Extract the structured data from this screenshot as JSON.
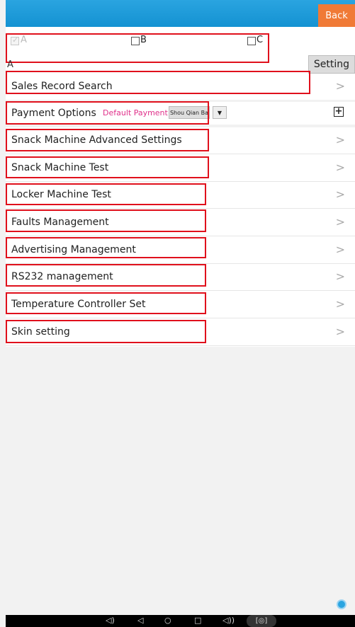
{
  "header": {
    "back_label": "Back"
  },
  "checkboxes": [
    {
      "label": "A",
      "checked": true,
      "disabled": true
    },
    {
      "label": "B",
      "checked": false
    },
    {
      "label": "C",
      "checked": false
    }
  ],
  "selected_label": "A",
  "setting_label": "Setting",
  "rows": [
    {
      "label": "Sales Record Search"
    },
    {
      "label": "Payment Options",
      "default_payment_label": "Default Payment:",
      "payment_value": "Shou Qian Ba"
    },
    {
      "label": "Snack Machine Advanced Settings"
    },
    {
      "label": "Snack Machine Test"
    },
    {
      "label": "Locker Machine Test"
    },
    {
      "label": "Faults Management"
    },
    {
      "label": "Advertising Management"
    },
    {
      "label": "RS232 management"
    },
    {
      "label": "Temperature Controller Set"
    },
    {
      "label": "Skin setting"
    }
  ],
  "colors": {
    "topbar": "#1a98d8",
    "back": "#f07a36",
    "highlight": "#e0101c",
    "default_payment": "#e0308a"
  },
  "icons": [
    "chevron-right-icon",
    "plus-icon",
    "dropdown-arrow-icon",
    "chat-icon",
    "volume-down-icon",
    "back-nav-icon",
    "home-nav-icon",
    "recents-nav-icon",
    "volume-up-icon",
    "camera-icon"
  ]
}
